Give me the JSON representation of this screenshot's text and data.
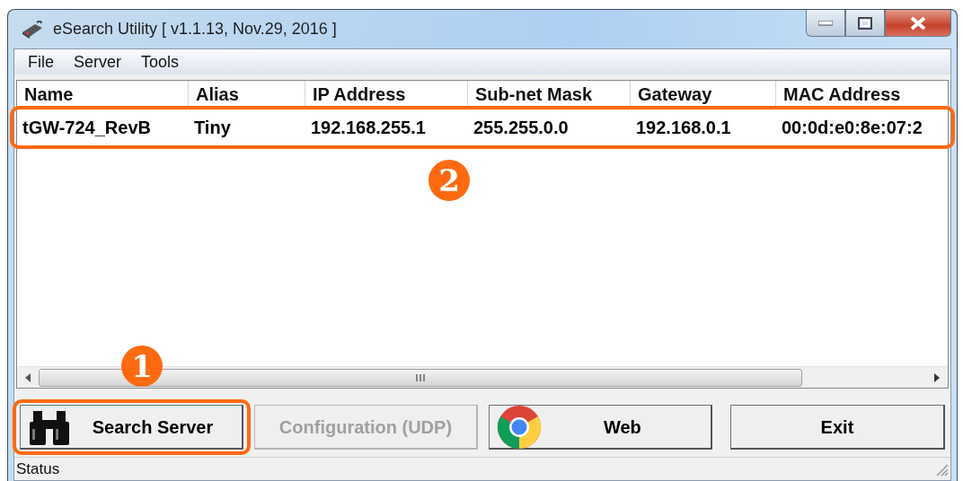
{
  "window": {
    "title": "eSearch Utility [ v1.1.13, Nov.29, 2016 ]"
  },
  "menu": [
    "File",
    "Server",
    "Tools"
  ],
  "table": {
    "columns": [
      "Name",
      "Alias",
      "IP Address",
      "Sub-net Mask",
      "Gateway",
      "MAC Address"
    ],
    "rows": [
      {
        "cells": [
          "tGW-724_RevB",
          "Tiny",
          "192.168.255.1",
          "255.255.0.0",
          "192.168.0.1",
          "00:0d:e0:8e:07:2"
        ],
        "highlighted": true,
        "step": "2"
      }
    ]
  },
  "buttons": [
    {
      "label": "Search Server",
      "kind": "binoculars",
      "disabled": false,
      "highlighted": true,
      "step": "1"
    },
    {
      "label": "Configuration (UDP)",
      "kind": "plain",
      "disabled": true,
      "highlighted": false
    },
    {
      "label": "Web",
      "kind": "browser",
      "disabled": false,
      "highlighted": false
    },
    {
      "label": "Exit",
      "kind": "plain",
      "disabled": false,
      "highlighted": false
    }
  ],
  "status_bar": "Status"
}
